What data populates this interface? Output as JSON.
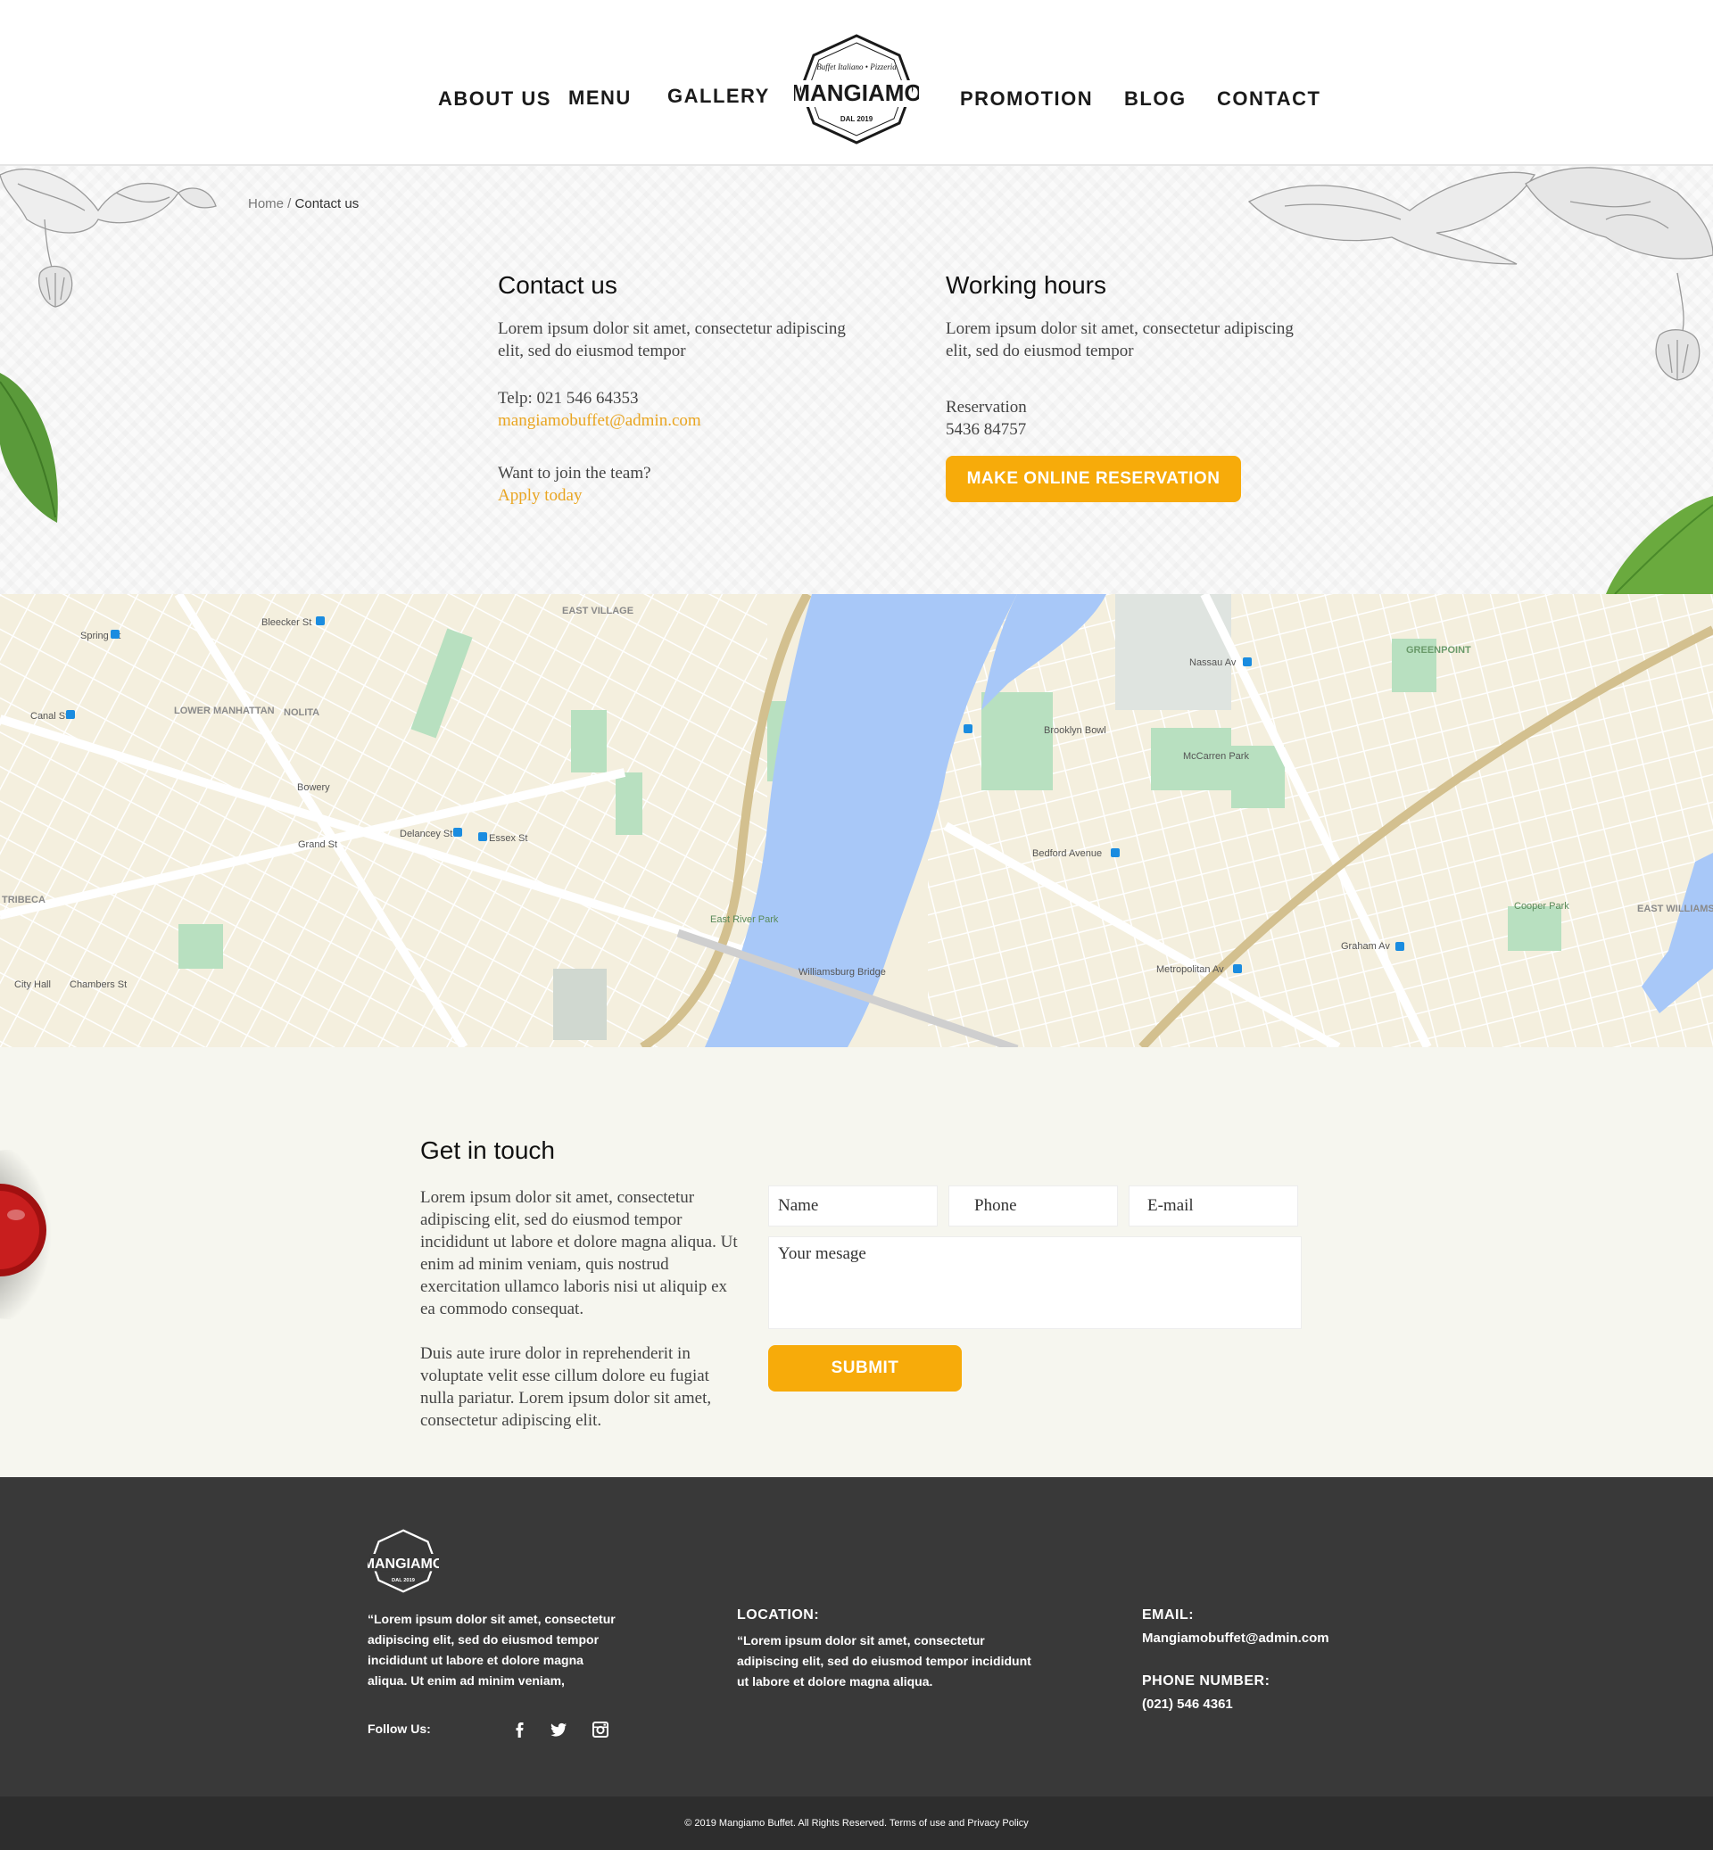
{
  "nav": {
    "about": "ABOUT US",
    "menu": "MENU",
    "gallery": "GALLERY",
    "promotion": "PROMOTION",
    "blog": "BLOG",
    "contact": "CONTACT"
  },
  "logo": {
    "name": "MANGIAMO",
    "tagline": "Buffet Italiano • Pizzeria",
    "since": "DAL 2019"
  },
  "breadcrumb": {
    "home": "Home",
    "separator": " / ",
    "current": "Contact us"
  },
  "contact": {
    "title": "Contact us",
    "text": "Lorem ipsum dolor sit amet, consectetur adipiscing elit, sed do eiusmod tempor",
    "phone": "Telp: 021 546 64353",
    "email": "mangiamobuffet@admin.com",
    "join": "Want to join the team?",
    "apply": "Apply today"
  },
  "hours": {
    "title": "Working hours",
    "text": "Lorem ipsum dolor sit amet, consectetur adipiscing elit, sed do eiusmod tempor",
    "reservation_label": "Reservation",
    "reservation_number": "5436 84757",
    "button": "MAKE ONLINE RESERVATION"
  },
  "map": {
    "labels": [
      "EAST VILLAGE",
      "LOWER MANHATTAN",
      "NOLITA",
      "TRIBECA",
      "GREENPOINT",
      "EAST WILLIAMSBURG",
      "Williamsburg Bridge",
      "Bleecker St",
      "Spring St",
      "Canal St",
      "Delancey St",
      "Essex St",
      "Grand St",
      "Bowery",
      "Bedford Avenue",
      "Nassau Av",
      "Metropolitan Av",
      "Graham Av",
      "McCarren Park",
      "Brooklyn Bowl",
      "Cooper Park",
      "East River Park",
      "City Hall",
      "Chambers St"
    ]
  },
  "touch": {
    "title": "Get in touch",
    "para1": "Lorem ipsum dolor sit amet, consectetur adipiscing elit, sed do eiusmod tempor incididunt ut labore et dolore magna aliqua. Ut enim ad minim veniam, quis nostrud exercitation ullamco laboris nisi ut aliquip ex ea commodo consequat.",
    "para2": "Duis aute irure dolor in reprehenderit in voluptate velit esse cillum dolore eu fugiat nulla pariatur. Lorem ipsum dolor sit amet, consectetur adipiscing elit.",
    "name_placeholder": "Name",
    "phone_placeholder": "Phone",
    "email_placeholder": "E-mail",
    "message_placeholder": "Your mesage",
    "submit": "SUBMIT"
  },
  "footer": {
    "about": "“Lorem ipsum dolor sit amet, consectetur adipiscing elit, sed do eiusmod tempor incididunt ut labore et dolore magna aliqua. Ut enim ad minim veniam,",
    "follow": "Follow Us:",
    "location_heading": "LOCATION:",
    "location_text": "“Lorem ipsum dolor sit amet, consectetur adipiscing elit, sed do eiusmod tempor incididunt ut labore et dolore magna aliqua.",
    "email_heading": "EMAIL:",
    "email_value": "Mangiamobuffet@admin.com",
    "phone_heading": "PHONE NUMBER:",
    "phone_value": "(021) 546 4361",
    "copyright": "© 2019 Mangiamo Buffet. All Rights Reserved. Terms of use and Privacy Policy"
  },
  "colors": {
    "accent": "#f7ab0a",
    "link": "#e9a521",
    "footer_bg": "#393939",
    "water": "#a8c8f8",
    "park": "#b8e0c0"
  },
  "icons": [
    "facebook-icon",
    "twitter-icon",
    "instagram-icon",
    "flower-decor-icon",
    "basil-leaf-icon",
    "sauce-bowl-icon"
  ]
}
